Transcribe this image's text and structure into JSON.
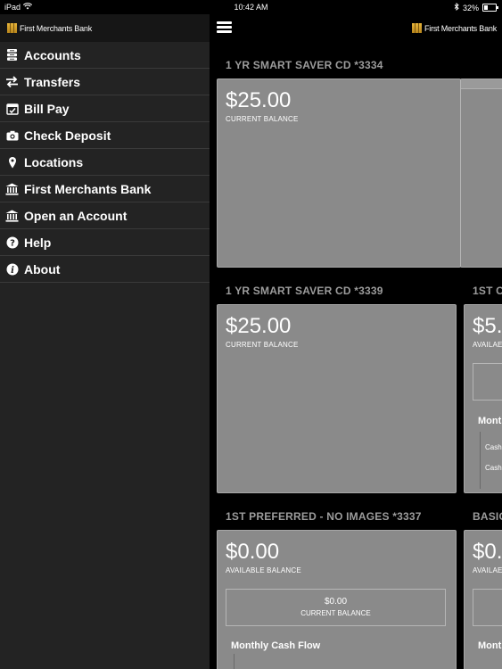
{
  "status": {
    "device": "iPad",
    "time": "10:42 AM",
    "battery": "32%",
    "battery_level": 0.32
  },
  "brand": {
    "name": "First Merchants Bank"
  },
  "menu": [
    {
      "label": "Accounts",
      "icon": "accounts-icon"
    },
    {
      "label": "Transfers",
      "icon": "transfer-arrows-icon"
    },
    {
      "label": "Bill Pay",
      "icon": "calendar-check-icon"
    },
    {
      "label": "Check Deposit",
      "icon": "camera-icon"
    },
    {
      "label": "Locations",
      "icon": "location-pin-icon"
    },
    {
      "label": "First Merchants Bank",
      "icon": "bank-icon"
    },
    {
      "label": "Open an Account",
      "icon": "bank-icon"
    },
    {
      "label": "Help",
      "icon": "help-icon"
    },
    {
      "label": "About",
      "icon": "info-icon"
    }
  ],
  "accounts": [
    {
      "title": "1 YR SMART SAVER CD *3334",
      "amount": "$25.00",
      "balance_label": "CURRENT BALANCE"
    },
    {
      "title": "1 YR SMART SAVER CD *3339",
      "amount": "$25.00",
      "balance_label": "CURRENT BALANCE"
    },
    {
      "title": "1ST C",
      "amount": "$5.",
      "balance_label": "AVAILAE",
      "cashflow_title": "Mont",
      "cash_labels": [
        "Cash",
        "Cash"
      ]
    },
    {
      "title": "1ST PREFERRED - NO IMAGES *3337",
      "amount": "$0.00",
      "balance_label": "AVAILABLE BALANCE",
      "sub_value": "$0.00",
      "sub_label": "CURRENT BALANCE",
      "cashflow_title": "Monthly Cash Flow"
    },
    {
      "title": "BASIC",
      "amount": "$0.",
      "balance_label": "AVAILAE",
      "cashflow_title": "Mont"
    }
  ],
  "colors": {
    "background": "#000000",
    "sidebar": "#232323",
    "card": "#8a8a8a",
    "section_title": "#9c9c9c",
    "brand_gold": "#d9a52e"
  }
}
